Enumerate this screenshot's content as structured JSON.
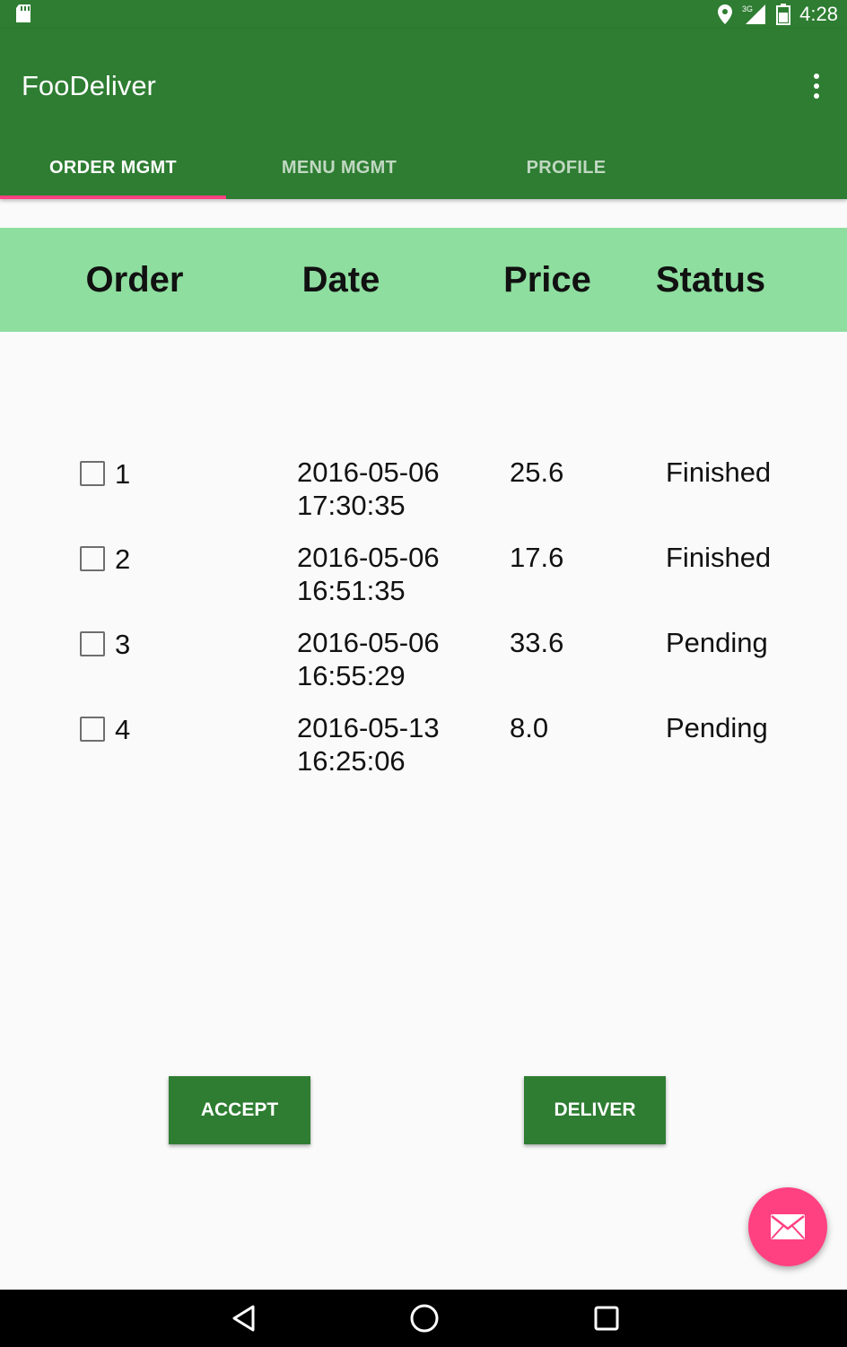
{
  "status_bar": {
    "time": "4:28",
    "network": "3G"
  },
  "app_bar": {
    "title": "FooDeliver"
  },
  "tabs": [
    {
      "label": "ORDER MGMT",
      "active": true
    },
    {
      "label": "MENU MGMT",
      "active": false
    },
    {
      "label": "PROFILE",
      "active": false
    }
  ],
  "table": {
    "headers": [
      "Order",
      "Date",
      "Price",
      "Status"
    ],
    "rows": [
      {
        "order": "1",
        "date": "2016-05-06",
        "time": "17:30:35",
        "price": "25.6",
        "status": "Finished",
        "checked": false
      },
      {
        "order": "2",
        "date": "2016-05-06",
        "time": "16:51:35",
        "price": "17.6",
        "status": "Finished",
        "checked": false
      },
      {
        "order": "3",
        "date": "2016-05-06",
        "time": "16:55:29",
        "price": "33.6",
        "status": "Pending",
        "checked": false
      },
      {
        "order": "4",
        "date": "2016-05-13",
        "time": "16:25:06",
        "price": "8.0",
        "status": "Pending",
        "checked": false
      }
    ]
  },
  "actions": {
    "accept_label": "ACCEPT",
    "deliver_label": "DELIVER"
  },
  "fab": {
    "icon": "mail-icon"
  },
  "colors": {
    "primary": "#2e7d32",
    "accent": "#ff4081",
    "header_band": "#8ede9f"
  }
}
